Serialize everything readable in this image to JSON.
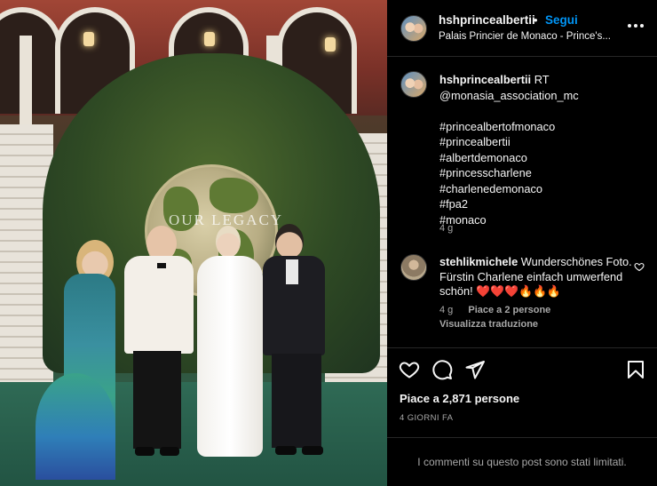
{
  "post": {
    "image_alt": "Four people posing in front of a green globe installation in a palace courtyard"
  },
  "header": {
    "username": "hshprincealbertii",
    "separator": "•",
    "follow_label": "Segui",
    "location": "Palais Princier de Monaco - Prince's..."
  },
  "caption": {
    "username": "hshprincealbertii",
    "lines": [
      "RT",
      "@monasia_association_mc",
      "⠀",
      "#princealbertofmonaco ⠀",
      "#princealbertii ⠀",
      "#albertdemonaco⠀",
      "#princesscharlene⠀",
      "#charlenedemonaco⠀",
      "#fpa2⠀",
      "#monaco⠀"
    ],
    "time": "4 g"
  },
  "comment": {
    "username": "stehlikmichele",
    "text": "Wunderschönes Foto. Fürstin Charlene einfach umwerfend schön! ❤️❤️❤️🔥🔥🔥",
    "time": "4 g",
    "likes": "Piace a 2 persone",
    "translate": "Visualizza traduzione"
  },
  "actions": {
    "likes": "Piace a 2,871 persone",
    "date": "4 GIORNI FA"
  },
  "footer": {
    "limited": "I commenti su questo post sono stati limitati."
  },
  "photo_text": {
    "globe": "OUR LEGACY"
  },
  "colors": {
    "accent": "#0095f6",
    "background": "#000000",
    "secondary_text": "#a8a8a8",
    "divider": "#262626"
  }
}
